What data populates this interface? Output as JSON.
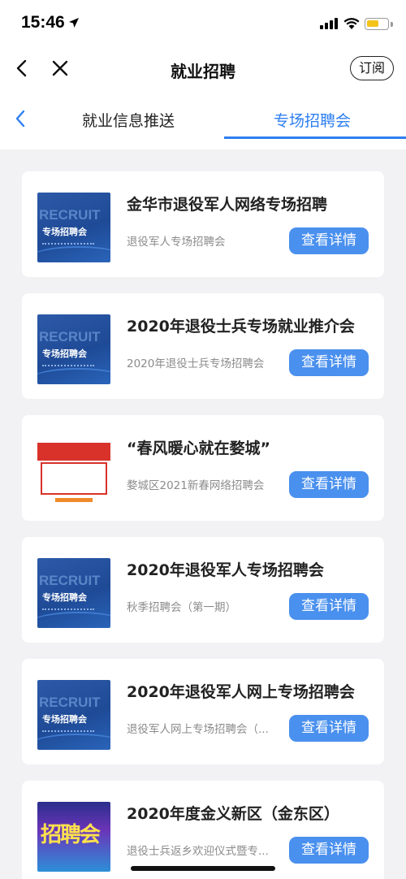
{
  "status": {
    "time": "15:46"
  },
  "nav": {
    "title": "就业招聘",
    "subscribe_label": "订阅"
  },
  "tabs": [
    {
      "label": "就业信息推送",
      "active": false
    },
    {
      "label": "专场招聘会",
      "active": true
    }
  ],
  "colors": {
    "accent": "#2f7ff0",
    "button": "#4a90ee"
  },
  "thumb_text": {
    "recruit_word": "RECRUIT",
    "recruit_cn": "专场招聘会",
    "fair_cn": "招聘会"
  },
  "cards": [
    {
      "title": "金华市退役军人网络专场招聘",
      "subtitle": "退役军人专场招聘会",
      "button": "查看详情",
      "thumb": "recruit-poster"
    },
    {
      "title": "2020年退役士兵专场就业推介会",
      "subtitle": "2020年退役士兵专场招聘会",
      "button": "查看详情",
      "thumb": "recruit-poster"
    },
    {
      "title": "“春风暖心就在婺城”",
      "subtitle": "婺城区2021新春网络招聘会",
      "button": "查看详情",
      "thumb": "red-webpage"
    },
    {
      "title": "2020年退役军人专场招聘会",
      "subtitle": "秋季招聘会（第一期）",
      "button": "查看详情",
      "thumb": "recruit-poster"
    },
    {
      "title": "2020年退役军人网上专场招聘会",
      "subtitle": "退役军人网上专场招聘会（...",
      "button": "查看详情",
      "thumb": "recruit-poster"
    },
    {
      "title": "2020年度金义新区（金东区）",
      "subtitle": "退役士兵返乡欢迎仪式暨专...",
      "button": "查看详情",
      "thumb": "fair-poster"
    }
  ]
}
